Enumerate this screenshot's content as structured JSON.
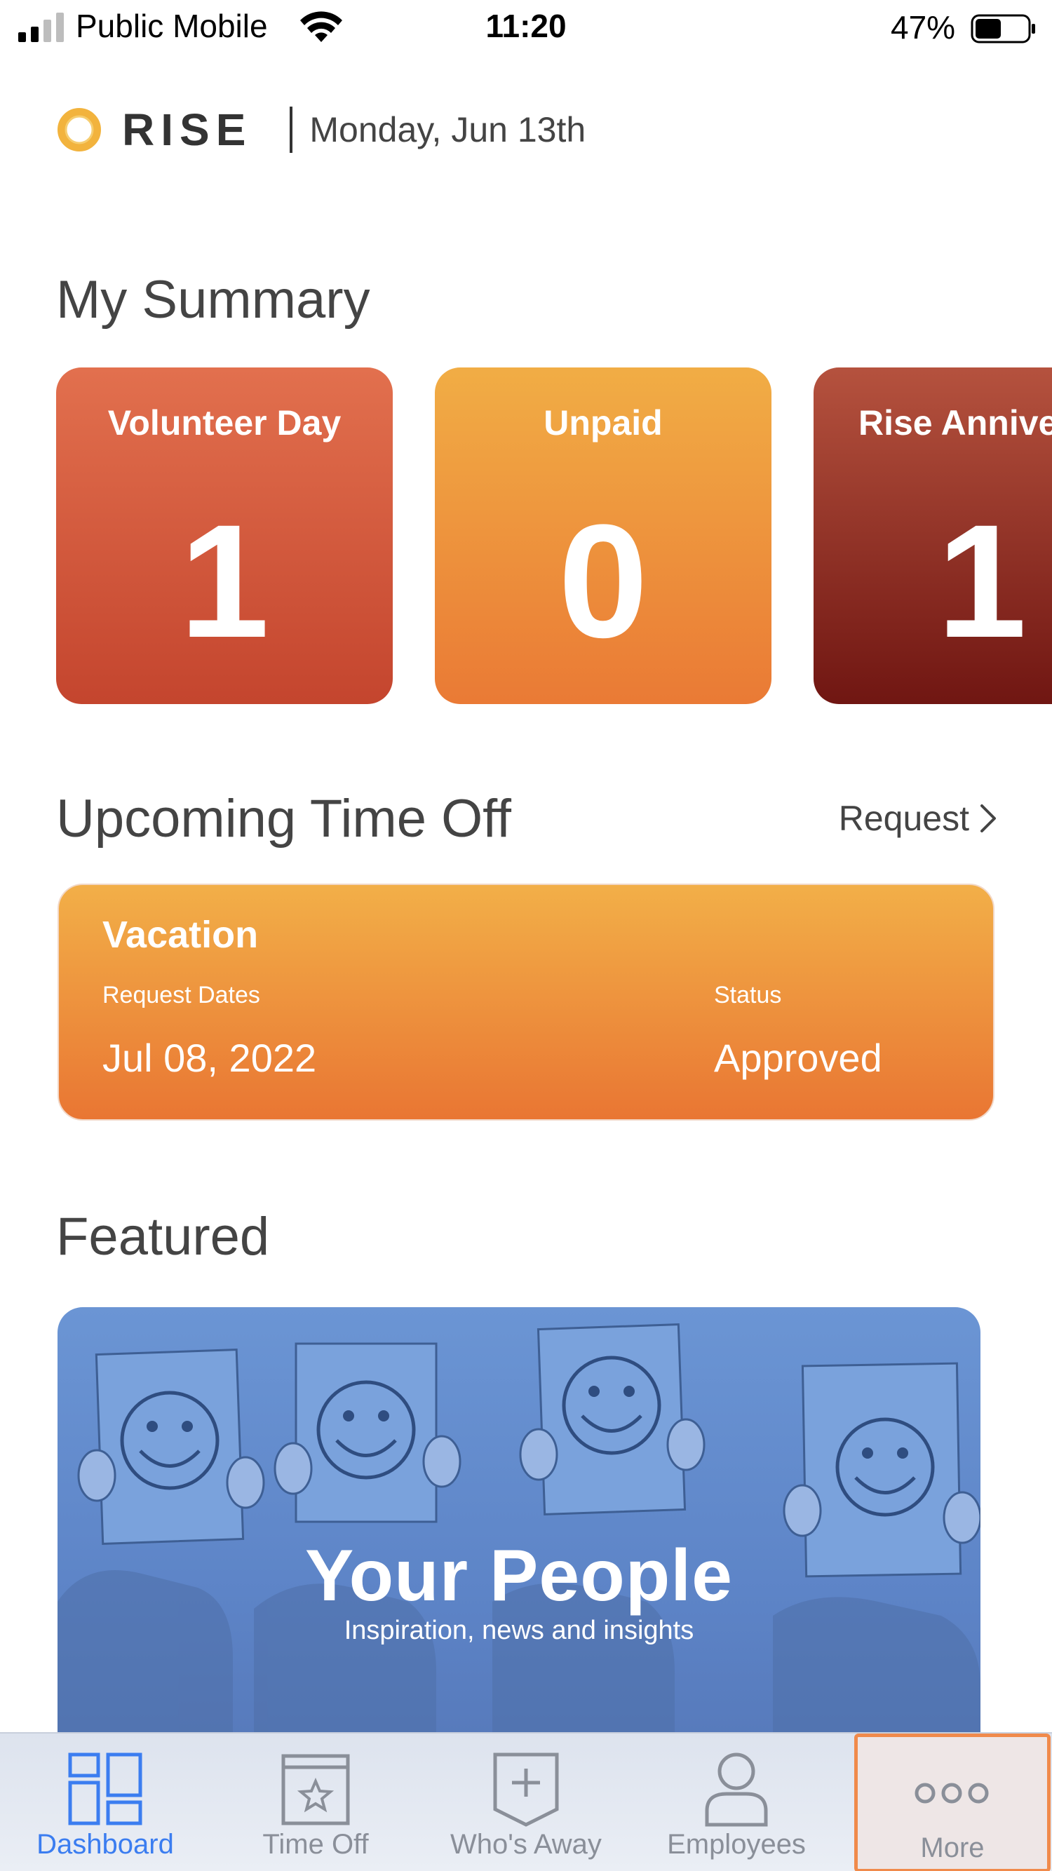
{
  "status_bar": {
    "carrier": "Public Mobile",
    "time": "11:20",
    "battery_percent": "47%"
  },
  "header": {
    "logo_text": "RISE",
    "date": "Monday, Jun 13th"
  },
  "summary": {
    "title": "My Summary",
    "cards": [
      {
        "title": "Volunteer Day",
        "value": "1"
      },
      {
        "title": "Unpaid",
        "value": "0"
      },
      {
        "title": "Rise Annive",
        "value": "1"
      }
    ]
  },
  "upcoming": {
    "title": "Upcoming Time Off",
    "request_link": "Request",
    "item": {
      "type": "Vacation",
      "dates_label": "Request Dates",
      "dates": "Jul 08, 2022",
      "status_label": "Status",
      "status": "Approved"
    }
  },
  "featured": {
    "title": "Featured",
    "banner_title": "Your People",
    "banner_subtitle": "Inspiration, news and insights"
  },
  "tabs": [
    {
      "label": "Dashboard",
      "icon": "dashboard-icon",
      "active": true
    },
    {
      "label": "Time Off",
      "icon": "calendar-star-icon",
      "active": false
    },
    {
      "label": "Who's Away",
      "icon": "badge-plus-icon",
      "active": false
    },
    {
      "label": "Employees",
      "icon": "person-icon",
      "active": false
    },
    {
      "label": "More",
      "icon": "more-dots-icon",
      "active": false
    }
  ],
  "colors": {
    "accent_blue": "#3b7df0",
    "card_red": "#c4452e",
    "card_orange": "#ea7a35",
    "card_maroon": "#701612",
    "logo_ring": "#f2b33d"
  }
}
